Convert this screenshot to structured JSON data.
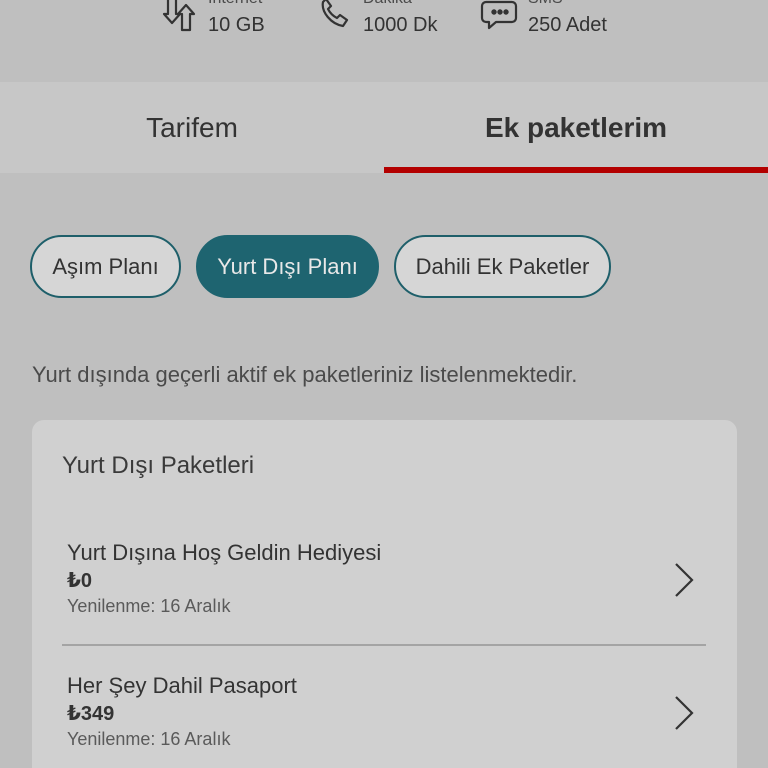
{
  "usage": [
    {
      "icon": "data-transfer-icon",
      "label": "İnternet",
      "value": "10 GB"
    },
    {
      "icon": "phone-icon",
      "label": "Dakika",
      "value": "1000 Dk"
    },
    {
      "icon": "sms-bubble-icon",
      "label": "SMS",
      "value": "250 Adet"
    }
  ],
  "tabs": [
    {
      "label": "Tarifem",
      "active": false
    },
    {
      "label": "Ek paketlerim",
      "active": true
    }
  ],
  "filters": [
    {
      "label": "Aşım Planı",
      "selected": false
    },
    {
      "label": "Yurt Dışı Planı",
      "selected": true
    },
    {
      "label": "Dahili Ek Paketler",
      "selected": false
    }
  ],
  "info_text": "Yurt dışında geçerli aktif ek paketleriniz listelenmektedir.",
  "card": {
    "title": "Yurt Dışı Paketleri",
    "packages": [
      {
        "name": "Yurt Dışına Hoş Geldin Hediyesi",
        "price": "₺0",
        "renewal": "Yenilenme: 16 Aralık"
      },
      {
        "name": "Her Şey Dahil Pasaport",
        "price": "₺349",
        "renewal": "Yenilenme: 16 Aralık"
      }
    ]
  },
  "colors": {
    "accent_teal": "#1e6470",
    "tab_indicator": "#b30000"
  }
}
